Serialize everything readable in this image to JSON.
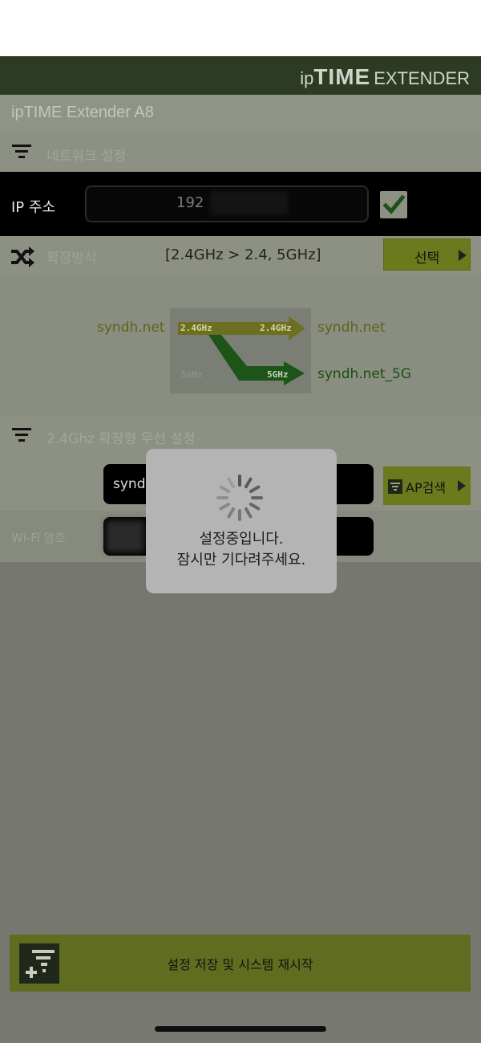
{
  "brand": {
    "ip": "ip",
    "time": "TIME",
    "extender": "EXTENDER"
  },
  "title": "ipTIME Extender A8",
  "network_section": {
    "label": "네트워크 설정"
  },
  "ip": {
    "label": "IP 주소",
    "value": "192",
    "checked": true
  },
  "extension": {
    "label": "확장방식",
    "value": "[2.4GHz > 2.4, 5GHz]",
    "select_label": "선택"
  },
  "diagram": {
    "ssid_source": "syndh.net",
    "ssid_24": "syndh.net",
    "ssid_5": "syndh.net_5G",
    "tag_in": "2.4GHz",
    "tag_out24": "2.4GHz",
    "tag_5_left": "5GHz",
    "tag_5_right": "5GHz"
  },
  "wireless_section": {
    "label": "2.4Ghz 확장형 무선 설정"
  },
  "ssid": {
    "value": "synd",
    "ap_search_label": "AP검색"
  },
  "wifi_password": {
    "label": "Wi-Fi 암호"
  },
  "save_button": {
    "label": "설정 저장 및 시스템 재시작"
  },
  "loading": {
    "line1": "설정중입니다.",
    "line2": "잠시만 기다려주세요."
  },
  "colors": {
    "accent_green": "#6b7a1d",
    "header_bg": "#2d3b23",
    "ssid_5g": "#1c4e12"
  }
}
